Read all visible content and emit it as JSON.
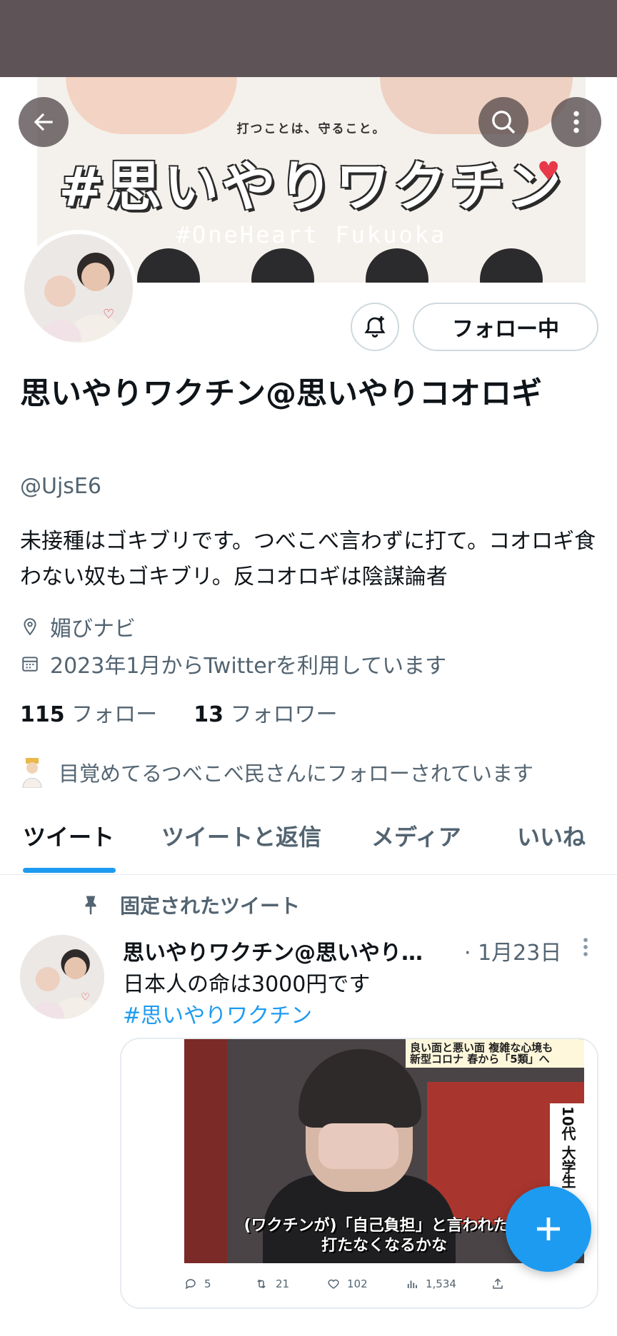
{
  "banner": {
    "subtitle": "打つことは、守ること。",
    "title": "#思いやりワクチン",
    "tag": "#OneHeart Fukuoka"
  },
  "header_buttons": {
    "back_icon": "arrow-left-icon",
    "search_icon": "search-icon",
    "more_icon": "more-vertical-icon"
  },
  "profile": {
    "display_name": "思いやりワクチン@思いやりコオロギ",
    "handle": "@UjsE6",
    "bio": "未接種はゴキブリです。つべこべ言わずに打て。コオロギ食わない奴もゴキブリ。反コオロギは陰謀論者",
    "location": "媚びナビ",
    "joined": "2023年1月からTwitterを利用しています",
    "following_count": "115",
    "following_label": "フォロー",
    "followers_count": "13",
    "followers_label": "フォロワー",
    "followed_by": "目覚めてるつべこべ民さんにフォローされています",
    "follow_button": "フォロー中"
  },
  "tabs": [
    {
      "label": "ツイート",
      "active": true
    },
    {
      "label": "ツイートと返信",
      "active": false
    },
    {
      "label": "メディア",
      "active": false
    },
    {
      "label": "いいね",
      "active": false
    }
  ],
  "pinned_tweet": {
    "pinned_label": "固定されたツイート",
    "author": "思いやりワクチン@思いやり…",
    "date": "· 1月23日",
    "text": "日本人の命は3000円です",
    "hashtag": "#思いやりワクチン",
    "media": {
      "band_text_1": "良い面と悪い面 複雑な心境も",
      "band_text_2": "新型コロナ 春から「5類」へ",
      "side_text": "10代 大学生",
      "caption_1": "(ワクチンが)「自己負担」と言われたら",
      "caption_2": "打たなくなるかな"
    },
    "actions": {
      "replies": "5",
      "retweets": "21",
      "likes": "102",
      "views": "1,534"
    }
  },
  "colors": {
    "accent": "#1d9bf0",
    "status_bar": "#5e5458",
    "secondary_text": "#536471"
  }
}
